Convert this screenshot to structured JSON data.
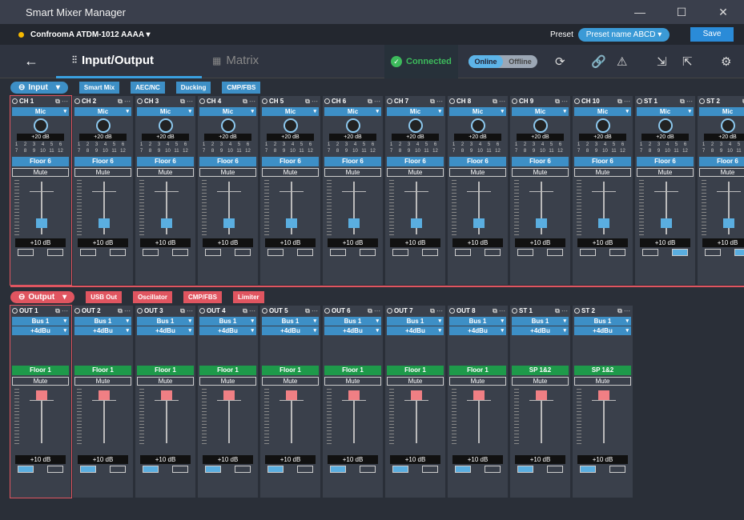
{
  "window": {
    "title": "Smart Mixer Manager",
    "min": "—",
    "max": "☐",
    "close": "✕"
  },
  "device": {
    "name": "ConfroomA ATDM-1012 AAAA ▾",
    "preset_label": "Preset",
    "preset_value": "Preset name ABCD ▾",
    "save": "Save"
  },
  "nav": {
    "back": "←",
    "io_tab": "Input/Output",
    "matrix_tab": "Matrix",
    "connected": "Connected",
    "online": "Online",
    "offline": "Offline",
    "colors": {
      "accent": "#3aa0e0",
      "connected": "#3dbb5c",
      "output": "#e05560"
    }
  },
  "input": {
    "title": "Input",
    "buttons": [
      "Smart Mix",
      "AEC/NC",
      "Ducking",
      "CMP/FBS"
    ],
    "channels": [
      {
        "name": "CH 1",
        "src": "Mic",
        "gain": "+20 dB",
        "zone": "Floor 6",
        "mute": "Mute",
        "val": "+10 dB",
        "lvl": 0.18
      },
      {
        "name": "CH 2",
        "src": "Mic",
        "gain": "+20 dB",
        "zone": "Floor 6",
        "mute": "Mute",
        "val": "+10 dB",
        "lvl": 0.18
      },
      {
        "name": "CH 3",
        "src": "Mic",
        "gain": "+20 dB",
        "zone": "Floor 6",
        "mute": "Mute",
        "val": "+10 dB",
        "lvl": 0.18
      },
      {
        "name": "CH 4",
        "src": "Mic",
        "gain": "+20 dB",
        "zone": "Floor 6",
        "mute": "Mute",
        "val": "+10 dB",
        "lvl": 0.18
      },
      {
        "name": "CH 5",
        "src": "Mic",
        "gain": "+20 dB",
        "zone": "Floor 6",
        "mute": "Mute",
        "val": "+10 dB",
        "lvl": 0.18
      },
      {
        "name": "CH 6",
        "src": "Mic",
        "gain": "+20 dB",
        "zone": "Floor 6",
        "mute": "Mute",
        "val": "+10 dB",
        "lvl": 0.18
      },
      {
        "name": "CH 7",
        "src": "Mic",
        "gain": "+20 dB",
        "zone": "Floor 6",
        "mute": "Mute",
        "val": "+10 dB",
        "lvl": 0.18
      },
      {
        "name": "CH 8",
        "src": "Mic",
        "gain": "+20 dB",
        "zone": "Floor 6",
        "mute": "Mute",
        "val": "+10 dB",
        "lvl": 0.18
      },
      {
        "name": "CH 9",
        "src": "Mic",
        "gain": "+20 dB",
        "zone": "Floor 6",
        "mute": "Mute",
        "val": "+10 dB",
        "lvl": 0.18
      },
      {
        "name": "CH 10",
        "src": "Mic",
        "gain": "+20 dB",
        "zone": "Floor 6",
        "mute": "Mute",
        "val": "+10 dB",
        "lvl": 0.18
      },
      {
        "name": "ST 1",
        "src": "Mic",
        "gain": "+20 dB",
        "zone": "Floor 6",
        "mute": "Mute",
        "val": "+10 dB",
        "lvl": 0.18
      },
      {
        "name": "ST 2",
        "src": "Mic",
        "gain": "+20 dB",
        "zone": "Floor 6",
        "mute": "Mute",
        "val": "+10 dB",
        "lvl": 0.18
      }
    ],
    "nums": [
      "1",
      "2",
      "3",
      "4",
      "5",
      "6",
      "7",
      "8",
      "9",
      "10",
      "11",
      "12"
    ]
  },
  "output": {
    "title": "Output",
    "buttons": [
      "USB Out",
      "Oscillator",
      "CMP/FBS",
      "Limiter"
    ],
    "channels": [
      {
        "name": "OUT 1",
        "bus": "Bus 1",
        "lvl_sel": "+4dBu",
        "zone": "Floor 1",
        "mute": "Mute",
        "val": "+10 dB"
      },
      {
        "name": "OUT 2",
        "bus": "Bus 1",
        "lvl_sel": "+4dBu",
        "zone": "Floor 1",
        "mute": "Mute",
        "val": "+10 dB"
      },
      {
        "name": "OUT 3",
        "bus": "Bus 1",
        "lvl_sel": "+4dBu",
        "zone": "Floor 1",
        "mute": "Mute",
        "val": "+10 dB"
      },
      {
        "name": "OUT 4",
        "bus": "Bus 1",
        "lvl_sel": "+4dBu",
        "zone": "Floor 1",
        "mute": "Mute",
        "val": "+10 dB"
      },
      {
        "name": "OUT 5",
        "bus": "Bus 1",
        "lvl_sel": "+4dBu",
        "zone": "Floor 1",
        "mute": "Mute",
        "val": "+10 dB"
      },
      {
        "name": "OUT 6",
        "bus": "Bus 1",
        "lvl_sel": "+4dBu",
        "zone": "Floor 1",
        "mute": "Mute",
        "val": "+10 dB"
      },
      {
        "name": "OUT 7",
        "bus": "Bus 1",
        "lvl_sel": "+4dBu",
        "zone": "Floor 1",
        "mute": "Mute",
        "val": "+10 dB"
      },
      {
        "name": "OUT 8",
        "bus": "Bus 1",
        "lvl_sel": "+4dBu",
        "zone": "Floor 1",
        "mute": "Mute",
        "val": "+10 dB"
      },
      {
        "name": "ST 1",
        "bus": "Bus 1",
        "lvl_sel": "+4dBu",
        "zone": "SP 1&2",
        "mute": "Mute",
        "val": "+10 dB"
      },
      {
        "name": "ST 2",
        "bus": "Bus 1",
        "lvl_sel": "+4dBu",
        "zone": "SP 1&2",
        "mute": "Mute",
        "val": "+10 dB"
      }
    ]
  }
}
